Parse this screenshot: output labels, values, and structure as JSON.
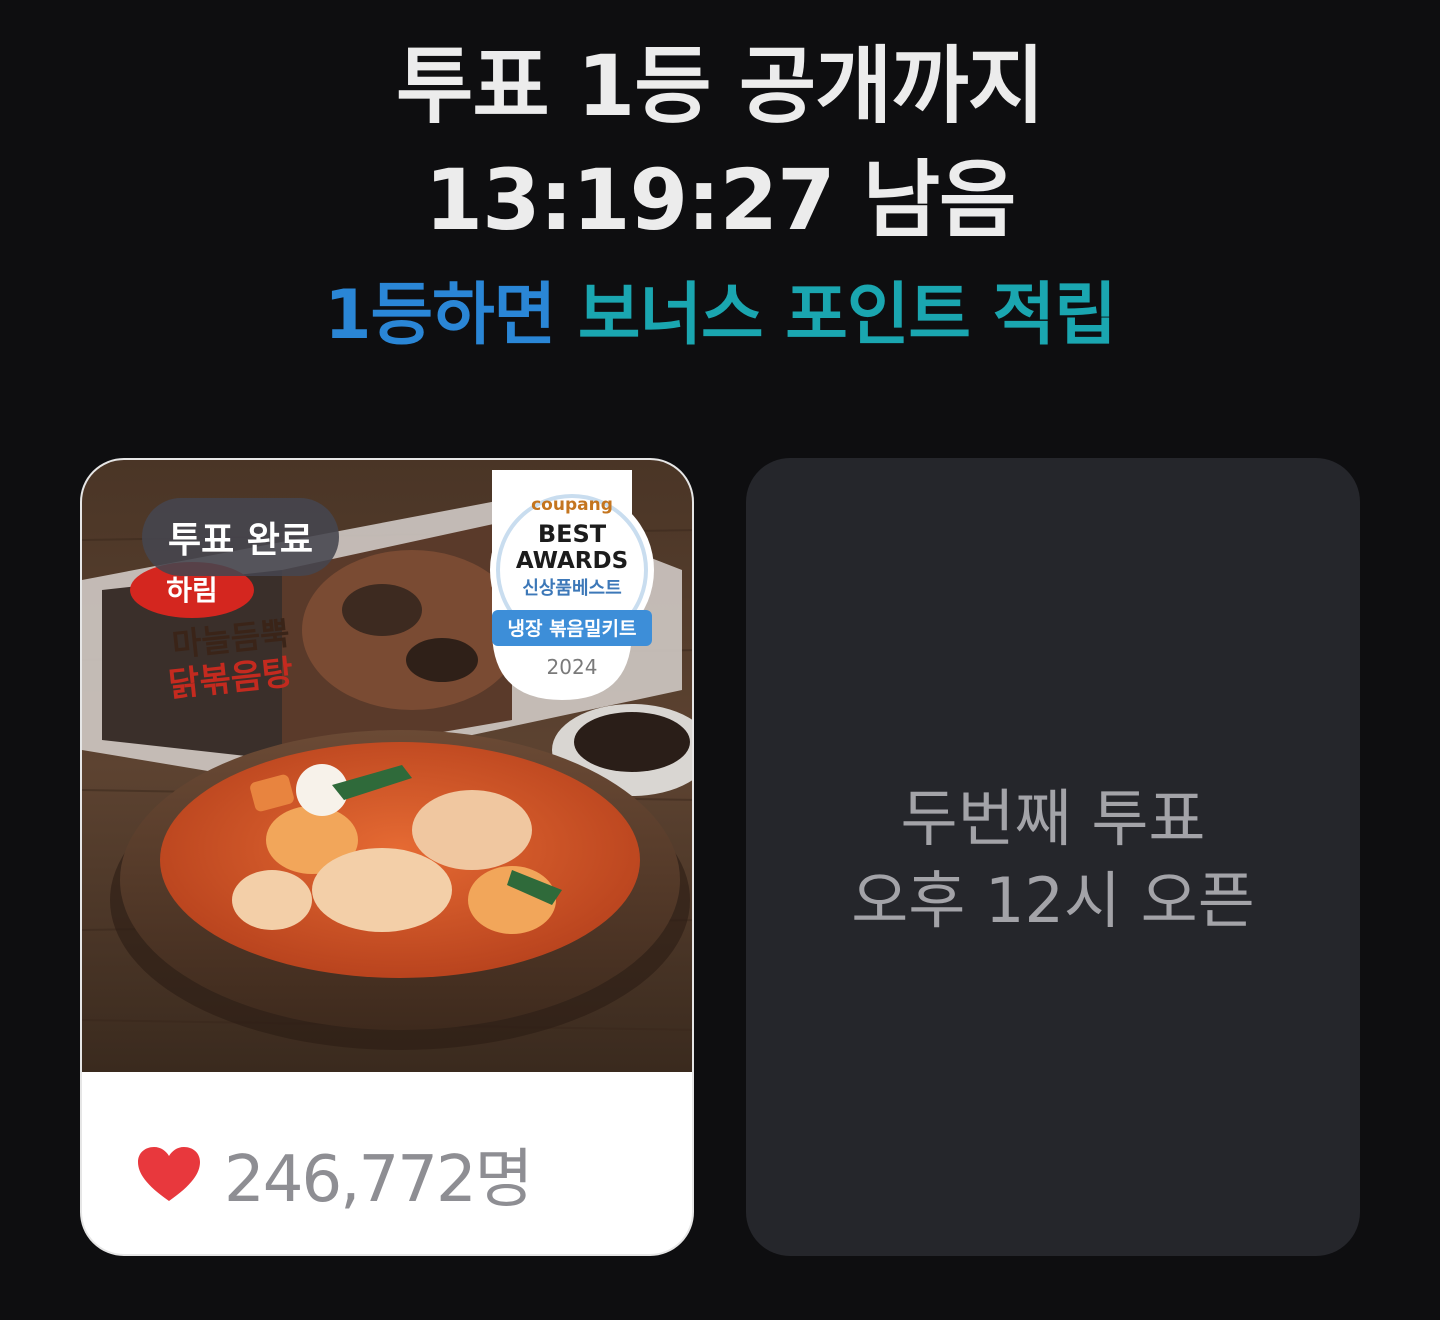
{
  "header": {
    "title_line1": "투표 1등 공개까지",
    "countdown": "13:19:27 남음",
    "bonus_part1": "1등하면",
    "bonus_part2": "보너스 포인트 적립"
  },
  "card1": {
    "badge": "투표 완료",
    "like_count": "246,772명",
    "product_image": {
      "brand_logo": "하림",
      "product_name": "마늘듬뿍 닭볶음탕",
      "award_brand": "coupang",
      "award_title_1": "BEST",
      "award_title_2": "AWARDS",
      "award_category": "신상품베스트",
      "award_ribbon": "냉장 볶음밀키트",
      "award_year": "2024"
    }
  },
  "card2": {
    "line1": "두번째 투표",
    "line2": "오후 12시 오픈"
  },
  "colors": {
    "background": "#0e0e10",
    "bonus_blue": "#2a86d6",
    "bonus_teal": "#1aa6b0",
    "heart": "#e8383d"
  }
}
